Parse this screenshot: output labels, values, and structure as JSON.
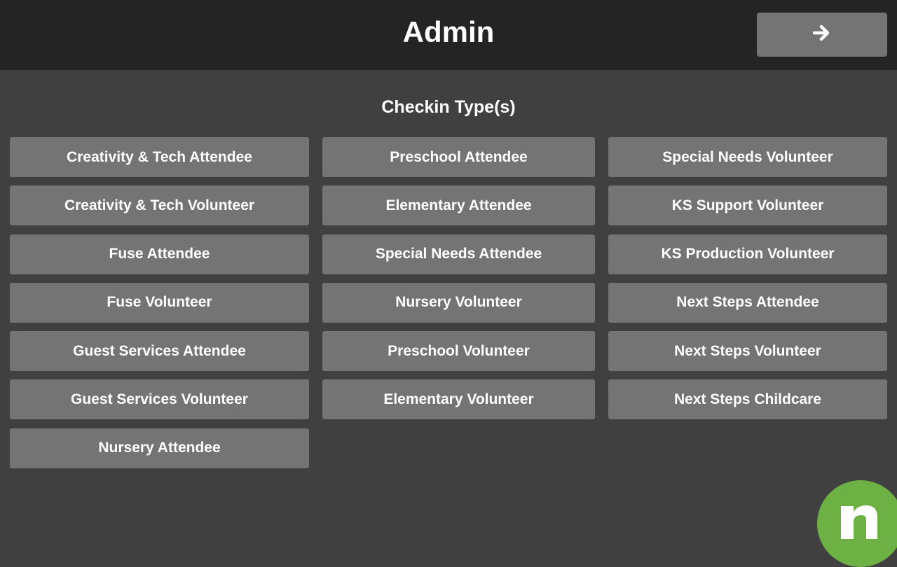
{
  "header": {
    "title": "Admin",
    "next_icon": "arrow-right-icon"
  },
  "section": {
    "title": "Checkin Type(s)"
  },
  "checkin_types": {
    "column1": [
      "Creativity & Tech Attendee",
      "Creativity & Tech Volunteer",
      "Fuse Attendee",
      "Fuse Volunteer",
      "Guest Services Attendee",
      "Guest Services Volunteer",
      "Nursery Attendee"
    ],
    "column2": [
      "Preschool Attendee",
      "Elementary Attendee",
      "Special Needs Attendee",
      "Nursery Volunteer",
      "Preschool Volunteer",
      "Elementary Volunteer"
    ],
    "column3": [
      "Special Needs Volunteer",
      "KS Support Volunteer",
      "KS Production Volunteer",
      "Next Steps Attendee",
      "Next Steps Volunteer",
      "Next Steps Childcare"
    ]
  },
  "logo": {
    "icon": "n-logo-icon",
    "color": "#6db043"
  },
  "colors": {
    "header_bg": "#242424",
    "page_bg": "#404040",
    "button_bg": "#747474",
    "text": "#ffffff"
  }
}
